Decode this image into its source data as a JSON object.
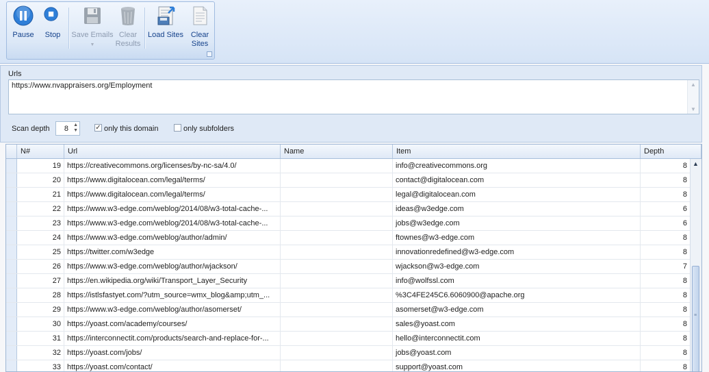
{
  "ribbon": {
    "buttons": {
      "pause": "Pause",
      "stop": "Stop",
      "save_emails": "Save Emails",
      "clear_results": "Clear\nResults",
      "load_sites": "Load Sites",
      "clear_sites": "Clear\nSites"
    }
  },
  "urls": {
    "label": "Urls",
    "value": "https://www.nvappraisers.org/Employment"
  },
  "options": {
    "scan_depth_label": "Scan depth",
    "scan_depth_value": "8",
    "only_this_domain": {
      "label": "only this domain",
      "checked": true
    },
    "only_subfolders": {
      "label": "only subfolders",
      "checked": false
    }
  },
  "grid": {
    "columns": [
      "N#",
      "Url",
      "Name",
      "Item",
      "Depth"
    ],
    "rows": [
      {
        "n": "19",
        "url": "https://creativecommons.org/licenses/by-nc-sa/4.0/",
        "name": "",
        "item": "info@creativecommons.org",
        "depth": "8"
      },
      {
        "n": "20",
        "url": "https://www.digitalocean.com/legal/terms/",
        "name": "",
        "item": "contact@digitalocean.com",
        "depth": "8"
      },
      {
        "n": "21",
        "url": "https://www.digitalocean.com/legal/terms/",
        "name": "",
        "item": "legal@digitalocean.com",
        "depth": "8"
      },
      {
        "n": "22",
        "url": "https://www.w3-edge.com/weblog/2014/08/w3-total-cache-...",
        "name": "",
        "item": "ideas@w3edge.com",
        "depth": "6"
      },
      {
        "n": "23",
        "url": "https://www.w3-edge.com/weblog/2014/08/w3-total-cache-...",
        "name": "",
        "item": "jobs@w3edge.com",
        "depth": "6"
      },
      {
        "n": "24",
        "url": "https://www.w3-edge.com/weblog/author/admin/",
        "name": "",
        "item": "ftownes@w3-edge.com",
        "depth": "8"
      },
      {
        "n": "25",
        "url": "https://twitter.com/w3edge",
        "name": "",
        "item": "innovationredefined@w3-edge.com",
        "depth": "8"
      },
      {
        "n": "26",
        "url": "https://www.w3-edge.com/weblog/author/wjackson/",
        "name": "",
        "item": "wjackson@w3-edge.com",
        "depth": "7"
      },
      {
        "n": "27",
        "url": "https://en.wikipedia.org/wiki/Transport_Layer_Security",
        "name": "",
        "item": "info@wolfssl.com",
        "depth": "8"
      },
      {
        "n": "28",
        "url": "https://istlsfastyet.com/?utm_source=wmx_blog&amp;utm_...",
        "name": "",
        "item": "%3C4FE245C6.6060900@apache.org",
        "depth": "8"
      },
      {
        "n": "29",
        "url": "https://www.w3-edge.com/weblog/author/asomerset/",
        "name": "",
        "item": "asomerset@w3-edge.com",
        "depth": "8"
      },
      {
        "n": "30",
        "url": "https://yoast.com/academy/courses/",
        "name": "",
        "item": "sales@yoast.com",
        "depth": "8"
      },
      {
        "n": "31",
        "url": "https://interconnectit.com/products/search-and-replace-for-...",
        "name": "",
        "item": "hello@interconnectit.com",
        "depth": "8"
      },
      {
        "n": "32",
        "url": "https://yoast.com/jobs/",
        "name": "",
        "item": "jobs@yoast.com",
        "depth": "8"
      },
      {
        "n": "33",
        "url": "https://yoast.com/contact/",
        "name": "",
        "item": "support@yoast.com",
        "depth": "8"
      }
    ]
  },
  "colors": {
    "accent_blue": "#2f7fd8",
    "ribbon_text": "#15428b",
    "disabled_text": "#8d9bb0"
  }
}
